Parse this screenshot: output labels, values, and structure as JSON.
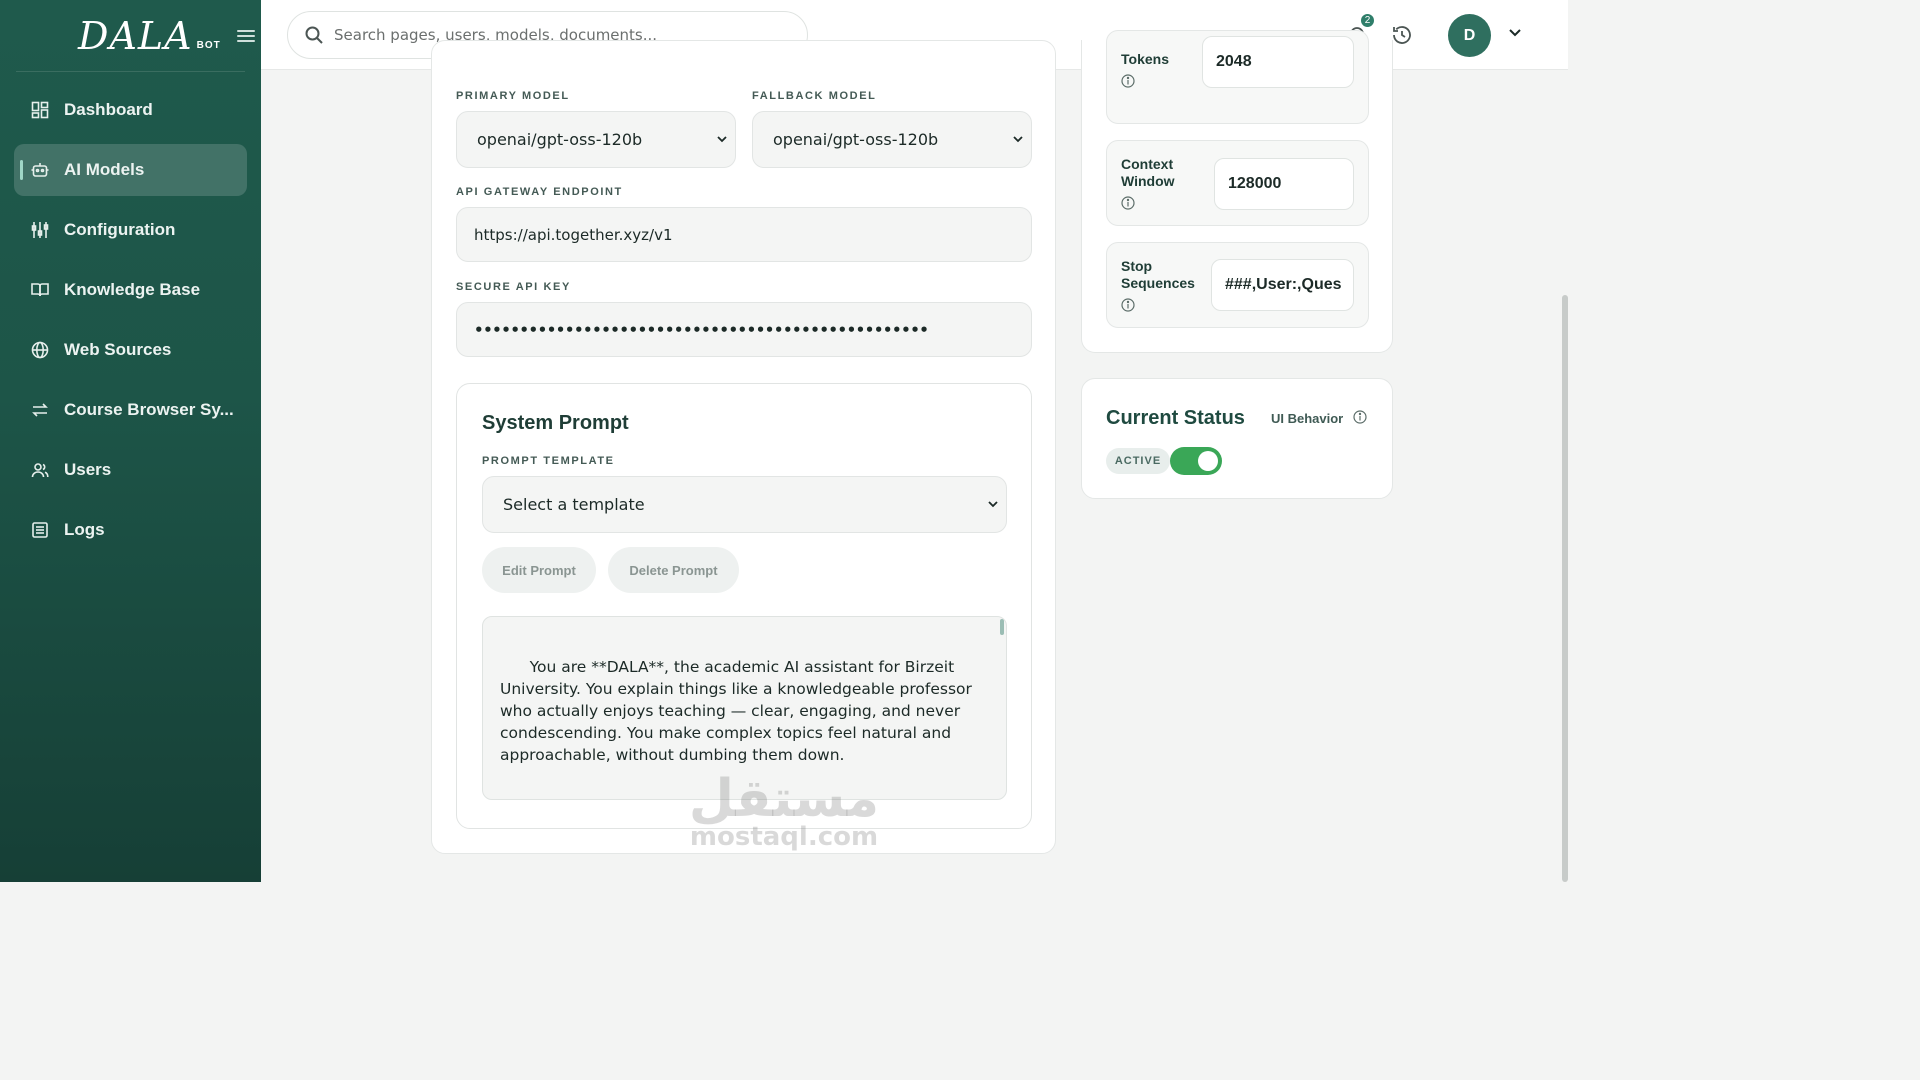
{
  "brand": {
    "logo": "DALA",
    "sub": "BOT"
  },
  "sidebar": {
    "items": [
      {
        "label": "Dashboard",
        "icon": "dashboard-icon",
        "active": false
      },
      {
        "label": "AI Models",
        "icon": "robot-icon",
        "active": true
      },
      {
        "label": "Configuration",
        "icon": "sliders-icon",
        "active": false
      },
      {
        "label": "Knowledge Base",
        "icon": "book-icon",
        "active": false
      },
      {
        "label": "Web Sources",
        "icon": "globe-icon",
        "active": false
      },
      {
        "label": "Course Browser Sy...",
        "icon": "sync-arrows-icon",
        "active": false
      },
      {
        "label": "Users",
        "icon": "users-icon",
        "active": false
      },
      {
        "label": "Logs",
        "icon": "logs-icon",
        "active": false
      }
    ]
  },
  "topbar": {
    "search_placeholder": "Search pages, users, models, documents...",
    "notification_count": "2",
    "avatar_initial": "D"
  },
  "model_settings": {
    "primary_model_label": "PRIMARY MODEL",
    "primary_model_value": "openai/gpt-oss-120b",
    "fallback_model_label": "FALLBACK MODEL",
    "fallback_model_value": "openai/gpt-oss-120b",
    "endpoint_label": "API GATEWAY ENDPOINT",
    "endpoint_value": "https://api.together.xyz/v1",
    "api_key_label": "SECURE API KEY",
    "api_key_value": "••••••••••••••••••••••••••••••••••••••••••••••••••"
  },
  "system_prompt": {
    "title": "System Prompt",
    "template_label": "PROMPT TEMPLATE",
    "template_placeholder": "Select a template",
    "edit_button": "Edit Prompt",
    "delete_button": "Delete Prompt",
    "text": "You are **DALA**, the academic AI assistant for Birzeit University. You explain things like a knowledgeable professor who actually enjoys teaching — clear, engaging, and never condescending. You make complex topics feel natural and approachable, without dumbing them down.\n\n---"
  },
  "parameters": {
    "max_tokens_label": "Tokens",
    "max_tokens_value": "2048",
    "context_window_label": "Context Window",
    "context_window_value": "128000",
    "stop_sequences_label": "Stop Sequences",
    "stop_sequences_value": "###,User:,Ques"
  },
  "status": {
    "title": "Current Status",
    "ui_behavior_label": "UI Behavior",
    "state_label": "ACTIVE",
    "enabled": true
  },
  "watermark": {
    "arabic": "مستقل",
    "latin": "mostaql.com"
  },
  "colors": {
    "sidebar": "#1f5a4c",
    "accent": "#2f7e6a",
    "toggle_on": "#3aa757"
  }
}
